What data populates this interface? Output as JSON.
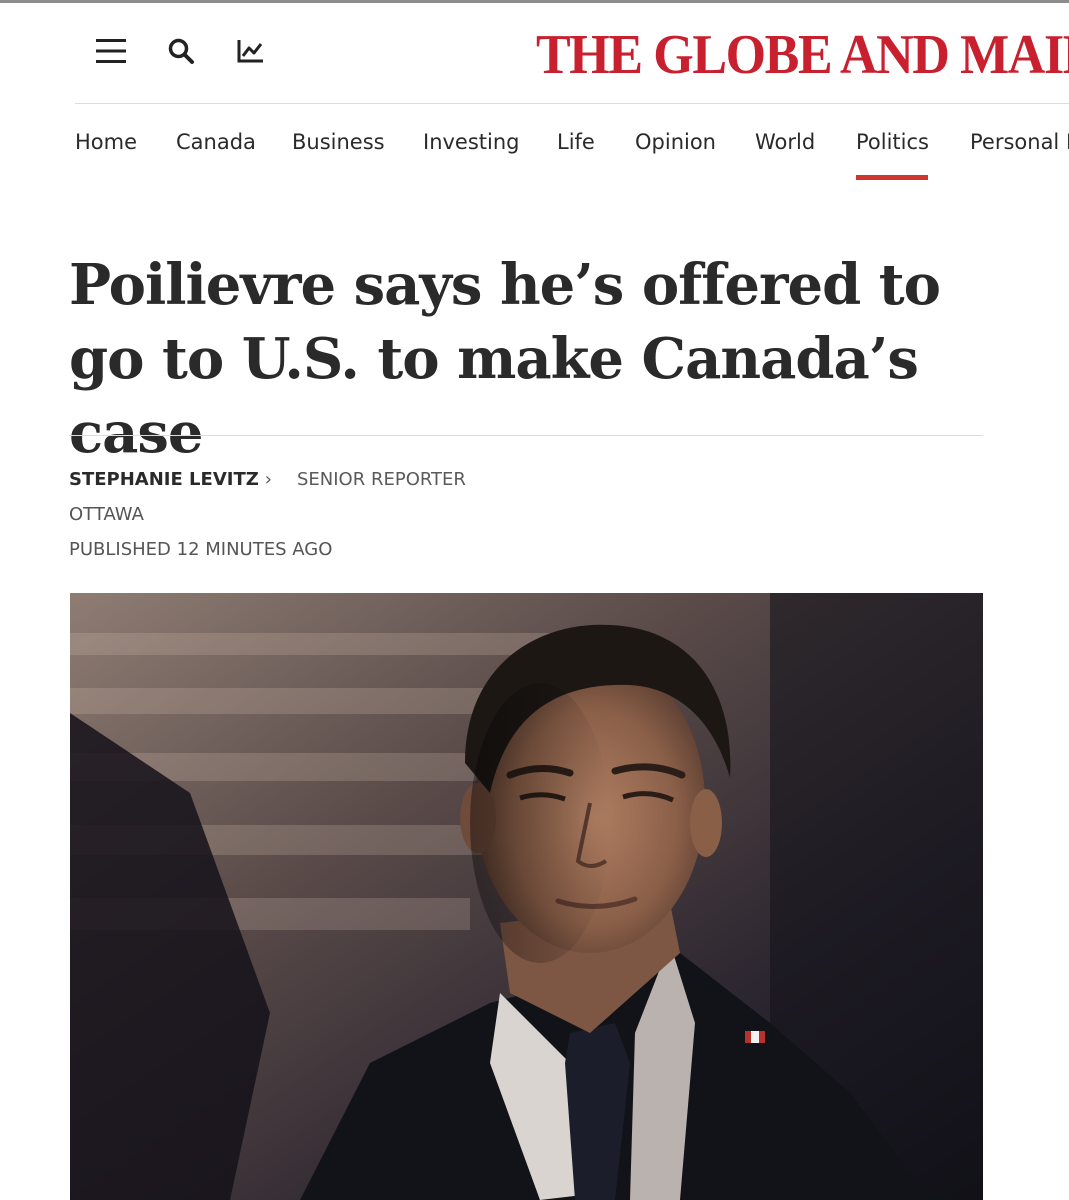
{
  "header": {
    "masthead": "THE GLOBE AND MAIL",
    "icons": [
      "menu-icon",
      "search-icon",
      "markets-chart-icon"
    ]
  },
  "nav": {
    "items": [
      "Home",
      "Canada",
      "Business",
      "Investing",
      "Life",
      "Opinion",
      "World",
      "Politics",
      "Personal F"
    ],
    "active": "Politics"
  },
  "article": {
    "headline": "Poilievre says he’s offered to go to U.S. to make Canada’s case",
    "author": "STEPHANIE LEVITZ",
    "author_chevron": "›",
    "role": "SENIOR REPORTER",
    "dateline": "OTTAWA",
    "published": "PUBLISHED 12 MINUTES AGO"
  },
  "colors": {
    "brand_red": "#c8202f",
    "active_underline": "#d0342c"
  }
}
